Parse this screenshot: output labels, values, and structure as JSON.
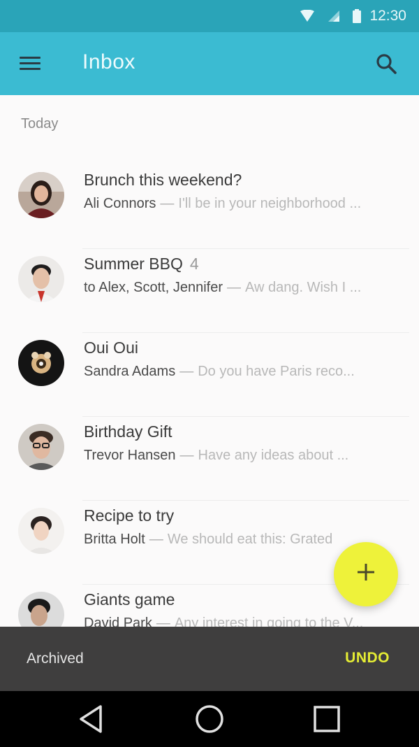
{
  "status_bar": {
    "time": "12:30",
    "icons": [
      "wifi-icon",
      "signal-icon",
      "battery-icon"
    ]
  },
  "app_bar": {
    "title": "Inbox",
    "menu_icon": "menu-icon",
    "search_icon": "search-icon",
    "color": "#3bbbd2"
  },
  "inbox": {
    "section_header": "Today",
    "items": [
      {
        "subject": "Brunch this weekend?",
        "count": "",
        "sender": "Ali Connors",
        "separator": "—",
        "preview": "I'll be in your neighborhood ..."
      },
      {
        "subject": "Summer BBQ",
        "count": "4",
        "sender": "to Alex, Scott, Jennifer",
        "separator": "—",
        "preview": "Aw dang. Wish I ..."
      },
      {
        "subject": "Oui Oui",
        "count": "",
        "sender": "Sandra Adams",
        "separator": "—",
        "preview": "Do you have Paris reco..."
      },
      {
        "subject": "Birthday Gift",
        "count": "",
        "sender": "Trevor Hansen",
        "separator": "—",
        "preview": "Have any ideas about ..."
      },
      {
        "subject": "Recipe to try",
        "count": "",
        "sender": "Britta Holt",
        "separator": "—",
        "preview": "We should eat this: Grated"
      },
      {
        "subject": "Giants game",
        "count": "",
        "sender": "David Park",
        "separator": "—",
        "preview": "Any interest in going to the V..."
      }
    ]
  },
  "fab": {
    "icon": "plus-icon",
    "color": "#eef23a"
  },
  "snackbar": {
    "message": "Archived",
    "action": "UNDO",
    "action_color": "#e4ec34"
  },
  "nav_bar": {
    "icons": [
      "back-icon",
      "home-icon",
      "recents-icon"
    ]
  }
}
